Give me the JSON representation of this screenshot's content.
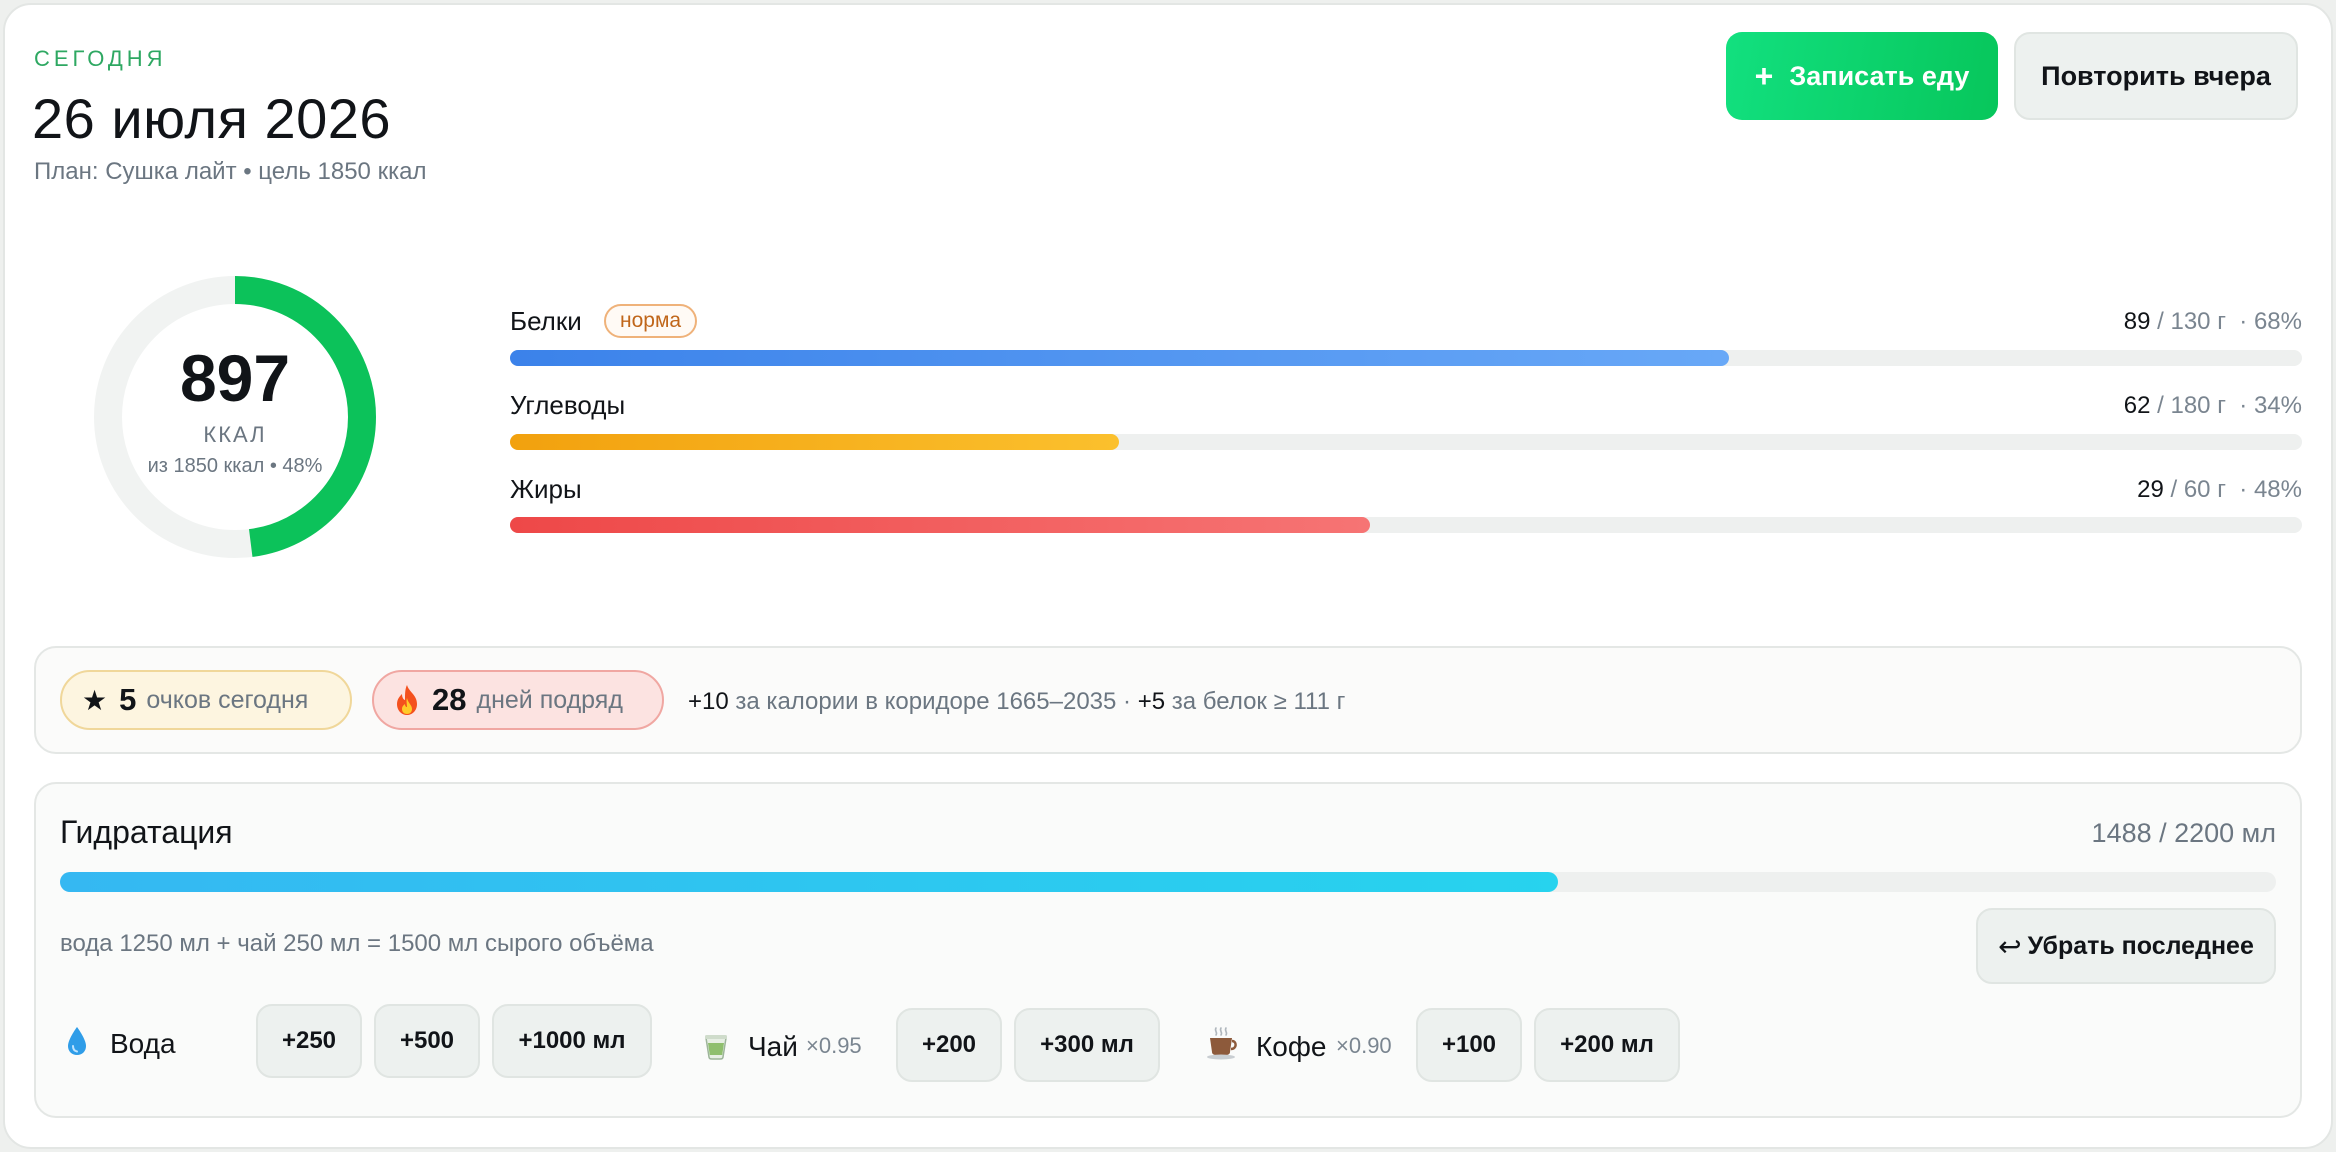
{
  "header": {
    "eyebrow": "СЕГОДНЯ",
    "date": "26 июля 2026",
    "plan": "План: Сушка лайт • цель 1850 ккал"
  },
  "actions": {
    "log_food": "Записать еду",
    "repeat_yesterday": "Повторить вчера"
  },
  "calories": {
    "value": "897",
    "unit": "ККАЛ",
    "subtitle": "из 1850 ккал • 48%",
    "fraction": 0.48,
    "color": "#0cc25a"
  },
  "macros": [
    {
      "name": "Белки",
      "badge": "норма",
      "current": "89",
      "target": "/ 130 г",
      "percent": "· 68%",
      "fraction": 0.68,
      "gradient": [
        "#3b82ea",
        "#68a8f7"
      ]
    },
    {
      "name": "Углеводы",
      "current": "62",
      "target": "/ 180 г",
      "percent": "· 34%",
      "fraction": 0.34,
      "gradient": [
        "#f2a10e",
        "#fbc02d"
      ]
    },
    {
      "name": "Жиры",
      "current": "29",
      "target": "/ 60 г",
      "percent": "· 48%",
      "fraction": 0.48,
      "gradient": [
        "#ee4848",
        "#f67474"
      ]
    }
  ],
  "points": {
    "score": "5",
    "score_label": "очков сегодня",
    "streak": "28",
    "streak_label": "дней подряд",
    "rule1_bonus": "+10",
    "rule1_text": "за калории в коридоре 1665–2035",
    "rule_sep": "·",
    "rule2_bonus": "+5",
    "rule2_text": "за белок ≥ 111 г"
  },
  "hydration": {
    "title": "Гидратация",
    "total": "1488 / 2200 мл",
    "fraction": 0.676,
    "formula": "вода 1250 мл + чай 250 мл = 1500 мл сырого объёма",
    "undo": "Убрать последнее",
    "water": {
      "label": "Вода",
      "buttons": [
        "+250",
        "+500",
        "+1000 мл"
      ]
    },
    "tea": {
      "label": "Чай",
      "mult": "×0.95",
      "buttons": [
        "+200",
        "+300 мл"
      ]
    },
    "coffee": {
      "label": "Кофе",
      "mult": "×0.90",
      "buttons": [
        "+100",
        "+200 мл"
      ]
    }
  }
}
